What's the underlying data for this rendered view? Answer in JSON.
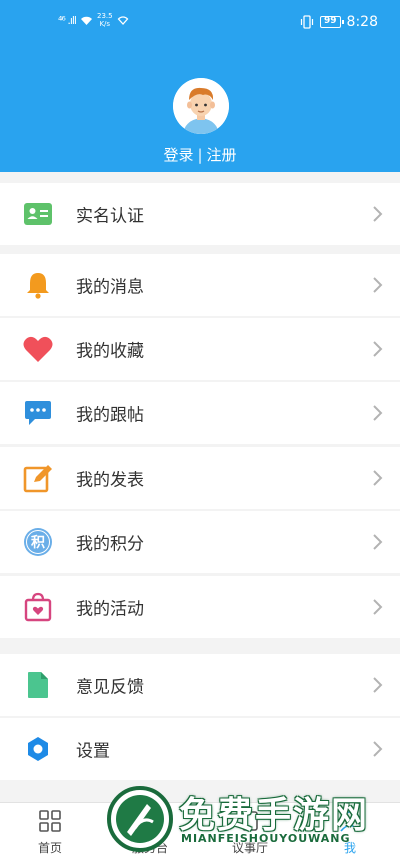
{
  "status_bar": {
    "signal": "⁴⁶ .ıll",
    "speed_top": "23.5",
    "speed_bottom": "K/s",
    "battery": "99",
    "time": "8:28"
  },
  "profile": {
    "login": "登录",
    "separator": "|",
    "register": "注册"
  },
  "menu": {
    "verify": "实名认证",
    "messages": "我的消息",
    "favorites": "我的收藏",
    "replies": "我的跟帖",
    "posts": "我的发表",
    "points": "我的积分",
    "points_icon_char": "积",
    "activities": "我的活动",
    "feedback": "意见反馈",
    "settings": "设置"
  },
  "bottom_nav": {
    "home": "首页",
    "service": "服务台",
    "hall": "议事厅",
    "me": "我"
  },
  "watermark": {
    "title": "免费手游网",
    "subtitle": "MIANFEISHOUYOUWANG"
  },
  "colors": {
    "header_blue": "#29a3ef",
    "verify_green": "#5ec26a",
    "bell_orange": "#f39a1e",
    "heart_red": "#f0505a",
    "reply_blue": "#2f8fdc",
    "post_orange": "#f0962a",
    "points_blue": "#6aaee8",
    "activity_pink": "#d6457f",
    "feedback_green": "#4bc58f",
    "settings_blue": "#1e8ae6"
  }
}
